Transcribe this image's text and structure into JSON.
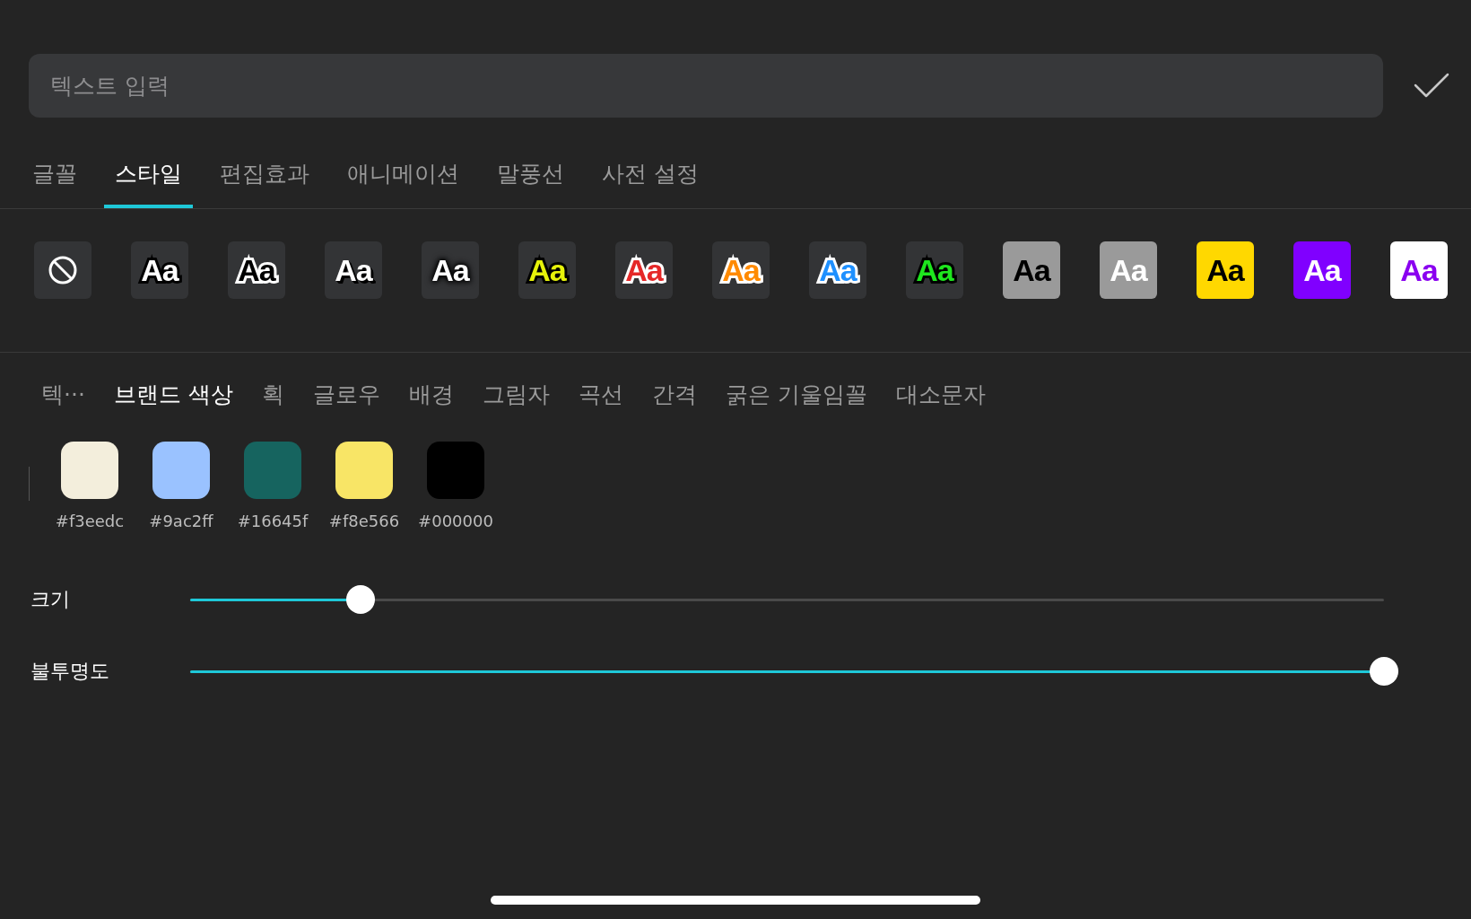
{
  "text_input": {
    "placeholder": "텍스트 입력"
  },
  "tabs": [
    {
      "label": "글꼴",
      "selected": false
    },
    {
      "label": "스타일",
      "selected": true
    },
    {
      "label": "편집효과",
      "selected": false
    },
    {
      "label": "애니메이션",
      "selected": false
    },
    {
      "label": "말풍선",
      "selected": false
    },
    {
      "label": "사전 설정",
      "selected": false
    }
  ],
  "presets": [
    {
      "kind": "none"
    },
    {
      "kind": "outline-dark",
      "label": "Aa",
      "color": "#ffffff"
    },
    {
      "kind": "outline-light",
      "label": "Aa",
      "color": "#000000"
    },
    {
      "kind": "shadow",
      "label": "Aa",
      "color": "#ffffff"
    },
    {
      "kind": "glow",
      "label": "Aa",
      "color": "#ffffff"
    },
    {
      "kind": "outline-dark",
      "label": "Aa",
      "color": "#e6f20a"
    },
    {
      "kind": "outline-light",
      "label": "Aa",
      "color": "#e52828"
    },
    {
      "kind": "outline-light",
      "label": "Aa",
      "color": "#ff8a00"
    },
    {
      "kind": "outline-light",
      "label": "Aa",
      "color": "#1e90ff"
    },
    {
      "kind": "outline-dark",
      "label": "Aa",
      "color": "#1ee61e"
    },
    {
      "kind": "tile-dark",
      "label": "Aa",
      "color": "#9a9a9a"
    },
    {
      "kind": "tile-light",
      "label": "Aa",
      "color": "#9a9a9a"
    },
    {
      "kind": "tile-dark",
      "label": "Aa",
      "color": "#ffd800"
    },
    {
      "kind": "tile-light",
      "label": "Aa",
      "color": "#8000ff"
    },
    {
      "kind": "tile-accent",
      "label": "Aa",
      "color": "#ffffff"
    }
  ],
  "sub_tabs": [
    {
      "label": "텍···",
      "selected": false
    },
    {
      "label": "브랜드 색상",
      "selected": true
    },
    {
      "label": "획",
      "selected": false
    },
    {
      "label": "글로우",
      "selected": false
    },
    {
      "label": "배경",
      "selected": false
    },
    {
      "label": "그림자",
      "selected": false
    },
    {
      "label": "곡선",
      "selected": false
    },
    {
      "label": "간격",
      "selected": false
    },
    {
      "label": "굵은 기울임꼴",
      "selected": false
    },
    {
      "label": "대소문자",
      "selected": false
    }
  ],
  "swatches": [
    {
      "label": "#f3eedc",
      "color": "#f3eedc"
    },
    {
      "label": "#9ac2ff",
      "color": "#9ac2ff"
    },
    {
      "label": "#16645f",
      "color": "#16645f"
    },
    {
      "label": "#f8e566",
      "color": "#f8e566"
    },
    {
      "label": "#000000",
      "color": "#000000"
    }
  ],
  "sliders": [
    {
      "label": "크기",
      "level": 0.143
    },
    {
      "label": "불투명도",
      "level": 1
    }
  ]
}
